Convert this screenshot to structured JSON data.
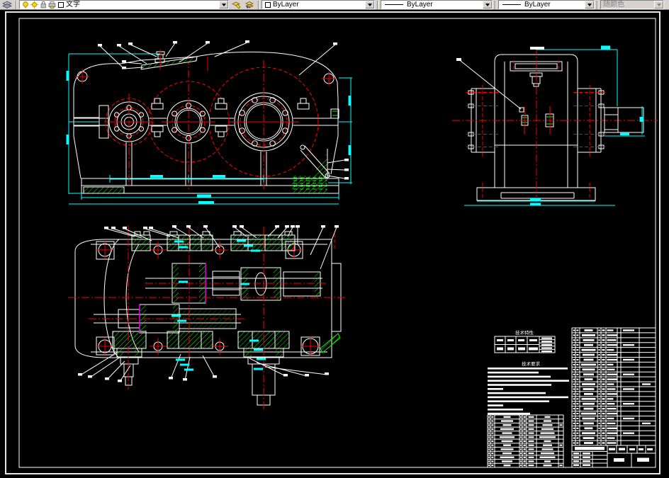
{
  "toolbar": {
    "layer_combo_value": "文字",
    "color_combo_value": "ByLayer",
    "linetype_combo_value": "ByLayer",
    "lineweight_combo_value": "ByLayer",
    "plot_style_value": "随颜色",
    "icons": [
      "layers-stack-icon",
      "bulb-icon",
      "sun-icon",
      "lock-icon",
      "printer-icon",
      "color-swatch",
      "make-object-layer-current-icon",
      "layer-previous-icon"
    ]
  },
  "tables": {
    "tech_spec_title": "技术特性",
    "tech_req_title": "技术要求"
  },
  "colors": {
    "toolbar_bg": "#d6d3ce",
    "canvas_bg": "#000000",
    "outline": "#ffffff",
    "centerline": "#fa0000",
    "hatch": "#00fa00",
    "dimension": "#00ffff",
    "highlight": "#ff00ff"
  },
  "views": {
    "front_view": "gearbox-front-view",
    "side_view": "gearbox-side-view",
    "plan_view": "gearbox-plan-section-view",
    "bom_table": "parts-list-table",
    "title_block": "title-block"
  }
}
